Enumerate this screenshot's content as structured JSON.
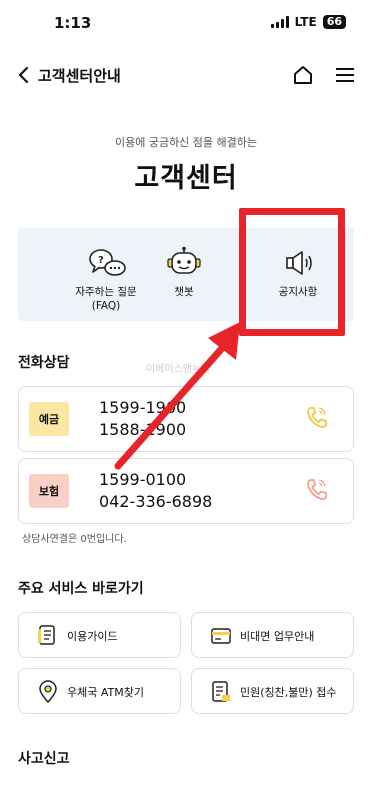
{
  "status_bar": {
    "time": "1:13",
    "network": "LTE",
    "battery": "66"
  },
  "nav": {
    "title": "고객센터안내"
  },
  "hero": {
    "subtitle": "이용에 궁금하신 점을 해결하는",
    "title": "고객센터"
  },
  "quick_menu": [
    {
      "label": "자주하는 질문\n(FAQ)",
      "icon": "faq-chat-bubbles-icon"
    },
    {
      "label": "챗봇",
      "icon": "chatbot-robot-icon"
    },
    {
      "label": "공지사항",
      "icon": "megaphone-icon"
    }
  ],
  "watermark": "이베이스앤뉴얼",
  "phone_section": {
    "title": "전화상담",
    "cards": [
      {
        "tag": "예금",
        "tag_color": "#fce6a4",
        "numbers": [
          "1599-1900",
          "1588-1900"
        ],
        "icon_color": "#f4c63c"
      },
      {
        "tag": "보험",
        "tag_color": "#fad0c6",
        "numbers": [
          "1599-0100",
          "042-336-6898"
        ],
        "icon_color": "#f0a08c"
      }
    ],
    "note": "상담사연결은 0번입니다."
  },
  "services": {
    "title": "주요 서비스 바로가기",
    "items": [
      {
        "label": "이용가이드",
        "icon": "document-icon"
      },
      {
        "label": "비대면 업무안내",
        "icon": "card-icon"
      },
      {
        "label": "우체국 ATM찾기",
        "icon": "location-pin-icon"
      },
      {
        "label": "민원(칭찬,불만) 접수",
        "icon": "form-edit-icon"
      }
    ]
  },
  "report_section": {
    "title": "사고신고"
  },
  "colors": {
    "highlight_red": "#e8232a",
    "quick_menu_bg": "#eef3fa",
    "accent_yellow": "#f7d14c"
  }
}
